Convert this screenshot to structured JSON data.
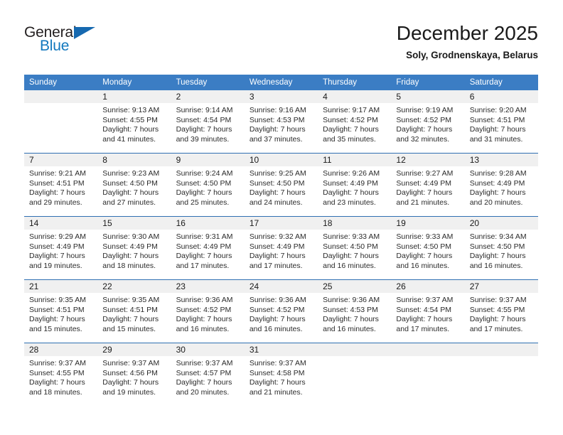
{
  "logo": {
    "word_top": "General",
    "word_bottom": "Blue",
    "triangle_icon": "triangle-icon",
    "color_dark": "#231f20",
    "color_blue": "#1278be"
  },
  "header": {
    "title": "December 2025",
    "subtitle": "Soly, Grodnenskaya, Belarus"
  },
  "theme": {
    "header_blue": "#3b7dc4",
    "row_divider_blue": "#2f6fb2",
    "daynum_band_gray": "#f0f0f0"
  },
  "calendar": {
    "day_headers": [
      "Sunday",
      "Monday",
      "Tuesday",
      "Wednesday",
      "Thursday",
      "Friday",
      "Saturday"
    ],
    "weeks": [
      [
        {
          "day": "",
          "lines": []
        },
        {
          "day": "1",
          "lines": [
            "Sunrise: 9:13 AM",
            "Sunset: 4:55 PM",
            "Daylight: 7 hours",
            "and 41 minutes."
          ]
        },
        {
          "day": "2",
          "lines": [
            "Sunrise: 9:14 AM",
            "Sunset: 4:54 PM",
            "Daylight: 7 hours",
            "and 39 minutes."
          ]
        },
        {
          "day": "3",
          "lines": [
            "Sunrise: 9:16 AM",
            "Sunset: 4:53 PM",
            "Daylight: 7 hours",
            "and 37 minutes."
          ]
        },
        {
          "day": "4",
          "lines": [
            "Sunrise: 9:17 AM",
            "Sunset: 4:52 PM",
            "Daylight: 7 hours",
            "and 35 minutes."
          ]
        },
        {
          "day": "5",
          "lines": [
            "Sunrise: 9:19 AM",
            "Sunset: 4:52 PM",
            "Daylight: 7 hours",
            "and 32 minutes."
          ]
        },
        {
          "day": "6",
          "lines": [
            "Sunrise: 9:20 AM",
            "Sunset: 4:51 PM",
            "Daylight: 7 hours",
            "and 31 minutes."
          ]
        }
      ],
      [
        {
          "day": "7",
          "lines": [
            "Sunrise: 9:21 AM",
            "Sunset: 4:51 PM",
            "Daylight: 7 hours",
            "and 29 minutes."
          ]
        },
        {
          "day": "8",
          "lines": [
            "Sunrise: 9:23 AM",
            "Sunset: 4:50 PM",
            "Daylight: 7 hours",
            "and 27 minutes."
          ]
        },
        {
          "day": "9",
          "lines": [
            "Sunrise: 9:24 AM",
            "Sunset: 4:50 PM",
            "Daylight: 7 hours",
            "and 25 minutes."
          ]
        },
        {
          "day": "10",
          "lines": [
            "Sunrise: 9:25 AM",
            "Sunset: 4:50 PM",
            "Daylight: 7 hours",
            "and 24 minutes."
          ]
        },
        {
          "day": "11",
          "lines": [
            "Sunrise: 9:26 AM",
            "Sunset: 4:49 PM",
            "Daylight: 7 hours",
            "and 23 minutes."
          ]
        },
        {
          "day": "12",
          "lines": [
            "Sunrise: 9:27 AM",
            "Sunset: 4:49 PM",
            "Daylight: 7 hours",
            "and 21 minutes."
          ]
        },
        {
          "day": "13",
          "lines": [
            "Sunrise: 9:28 AM",
            "Sunset: 4:49 PM",
            "Daylight: 7 hours",
            "and 20 minutes."
          ]
        }
      ],
      [
        {
          "day": "14",
          "lines": [
            "Sunrise: 9:29 AM",
            "Sunset: 4:49 PM",
            "Daylight: 7 hours",
            "and 19 minutes."
          ]
        },
        {
          "day": "15",
          "lines": [
            "Sunrise: 9:30 AM",
            "Sunset: 4:49 PM",
            "Daylight: 7 hours",
            "and 18 minutes."
          ]
        },
        {
          "day": "16",
          "lines": [
            "Sunrise: 9:31 AM",
            "Sunset: 4:49 PM",
            "Daylight: 7 hours",
            "and 17 minutes."
          ]
        },
        {
          "day": "17",
          "lines": [
            "Sunrise: 9:32 AM",
            "Sunset: 4:49 PM",
            "Daylight: 7 hours",
            "and 17 minutes."
          ]
        },
        {
          "day": "18",
          "lines": [
            "Sunrise: 9:33 AM",
            "Sunset: 4:50 PM",
            "Daylight: 7 hours",
            "and 16 minutes."
          ]
        },
        {
          "day": "19",
          "lines": [
            "Sunrise: 9:33 AM",
            "Sunset: 4:50 PM",
            "Daylight: 7 hours",
            "and 16 minutes."
          ]
        },
        {
          "day": "20",
          "lines": [
            "Sunrise: 9:34 AM",
            "Sunset: 4:50 PM",
            "Daylight: 7 hours",
            "and 16 minutes."
          ]
        }
      ],
      [
        {
          "day": "21",
          "lines": [
            "Sunrise: 9:35 AM",
            "Sunset: 4:51 PM",
            "Daylight: 7 hours",
            "and 15 minutes."
          ]
        },
        {
          "day": "22",
          "lines": [
            "Sunrise: 9:35 AM",
            "Sunset: 4:51 PM",
            "Daylight: 7 hours",
            "and 15 minutes."
          ]
        },
        {
          "day": "23",
          "lines": [
            "Sunrise: 9:36 AM",
            "Sunset: 4:52 PM",
            "Daylight: 7 hours",
            "and 16 minutes."
          ]
        },
        {
          "day": "24",
          "lines": [
            "Sunrise: 9:36 AM",
            "Sunset: 4:52 PM",
            "Daylight: 7 hours",
            "and 16 minutes."
          ]
        },
        {
          "day": "25",
          "lines": [
            "Sunrise: 9:36 AM",
            "Sunset: 4:53 PM",
            "Daylight: 7 hours",
            "and 16 minutes."
          ]
        },
        {
          "day": "26",
          "lines": [
            "Sunrise: 9:37 AM",
            "Sunset: 4:54 PM",
            "Daylight: 7 hours",
            "and 17 minutes."
          ]
        },
        {
          "day": "27",
          "lines": [
            "Sunrise: 9:37 AM",
            "Sunset: 4:55 PM",
            "Daylight: 7 hours",
            "and 17 minutes."
          ]
        }
      ],
      [
        {
          "day": "28",
          "lines": [
            "Sunrise: 9:37 AM",
            "Sunset: 4:55 PM",
            "Daylight: 7 hours",
            "and 18 minutes."
          ]
        },
        {
          "day": "29",
          "lines": [
            "Sunrise: 9:37 AM",
            "Sunset: 4:56 PM",
            "Daylight: 7 hours",
            "and 19 minutes."
          ]
        },
        {
          "day": "30",
          "lines": [
            "Sunrise: 9:37 AM",
            "Sunset: 4:57 PM",
            "Daylight: 7 hours",
            "and 20 minutes."
          ]
        },
        {
          "day": "31",
          "lines": [
            "Sunrise: 9:37 AM",
            "Sunset: 4:58 PM",
            "Daylight: 7 hours",
            "and 21 minutes."
          ]
        },
        {
          "day": "",
          "lines": []
        },
        {
          "day": "",
          "lines": []
        },
        {
          "day": "",
          "lines": []
        }
      ]
    ]
  }
}
